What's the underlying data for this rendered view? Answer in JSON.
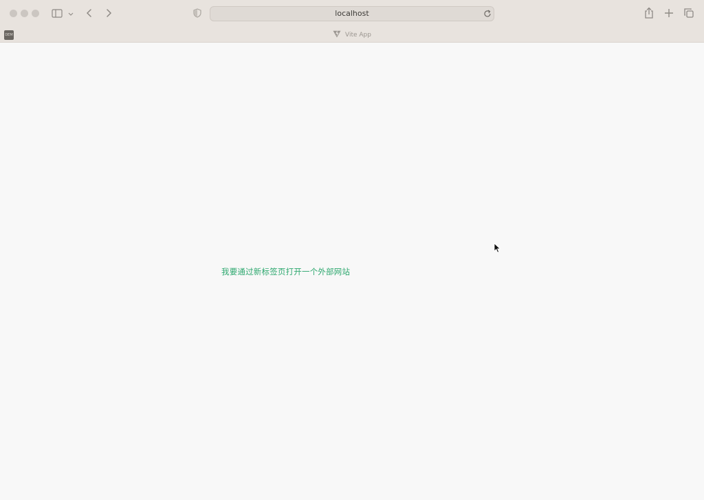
{
  "browser": {
    "url": "localhost",
    "tab_title": "Vite App",
    "tab_thumbnail_text": "DEM",
    "icons": {
      "sidebar": "sidebar-icon",
      "back": "chevron-left-icon",
      "forward": "chevron-right-icon",
      "privacy": "shield-icon",
      "reload": "reload-icon",
      "share": "share-icon",
      "new_tab": "plus-icon",
      "tab_overview": "tabs-icon"
    }
  },
  "page": {
    "link_label": "我要通过新标签页打开一个外部网站",
    "link_color": "#2ea86f"
  }
}
